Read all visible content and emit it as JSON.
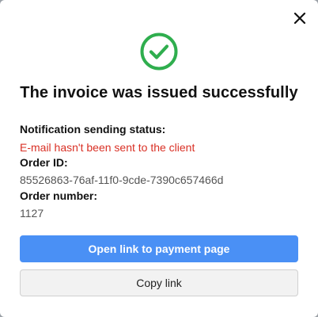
{
  "modal": {
    "title": "The invoice was issued successfully",
    "notification_label": "Notification sending status:",
    "notification_value": "E-mail hasn't been sent to the client",
    "order_id_label": "Order ID:",
    "order_id_value": "85526863-76af-11f0-9cde-7390c657466d",
    "order_number_label": "Order number:",
    "order_number_value": "1127",
    "primary_button": "Open link to payment page",
    "secondary_button": "Copy link"
  },
  "icons": {
    "success": "check-circle-icon",
    "close": "close-icon"
  },
  "colors": {
    "success": "#2fae4e",
    "error": "#d93025",
    "primary": "#4a90f5"
  }
}
